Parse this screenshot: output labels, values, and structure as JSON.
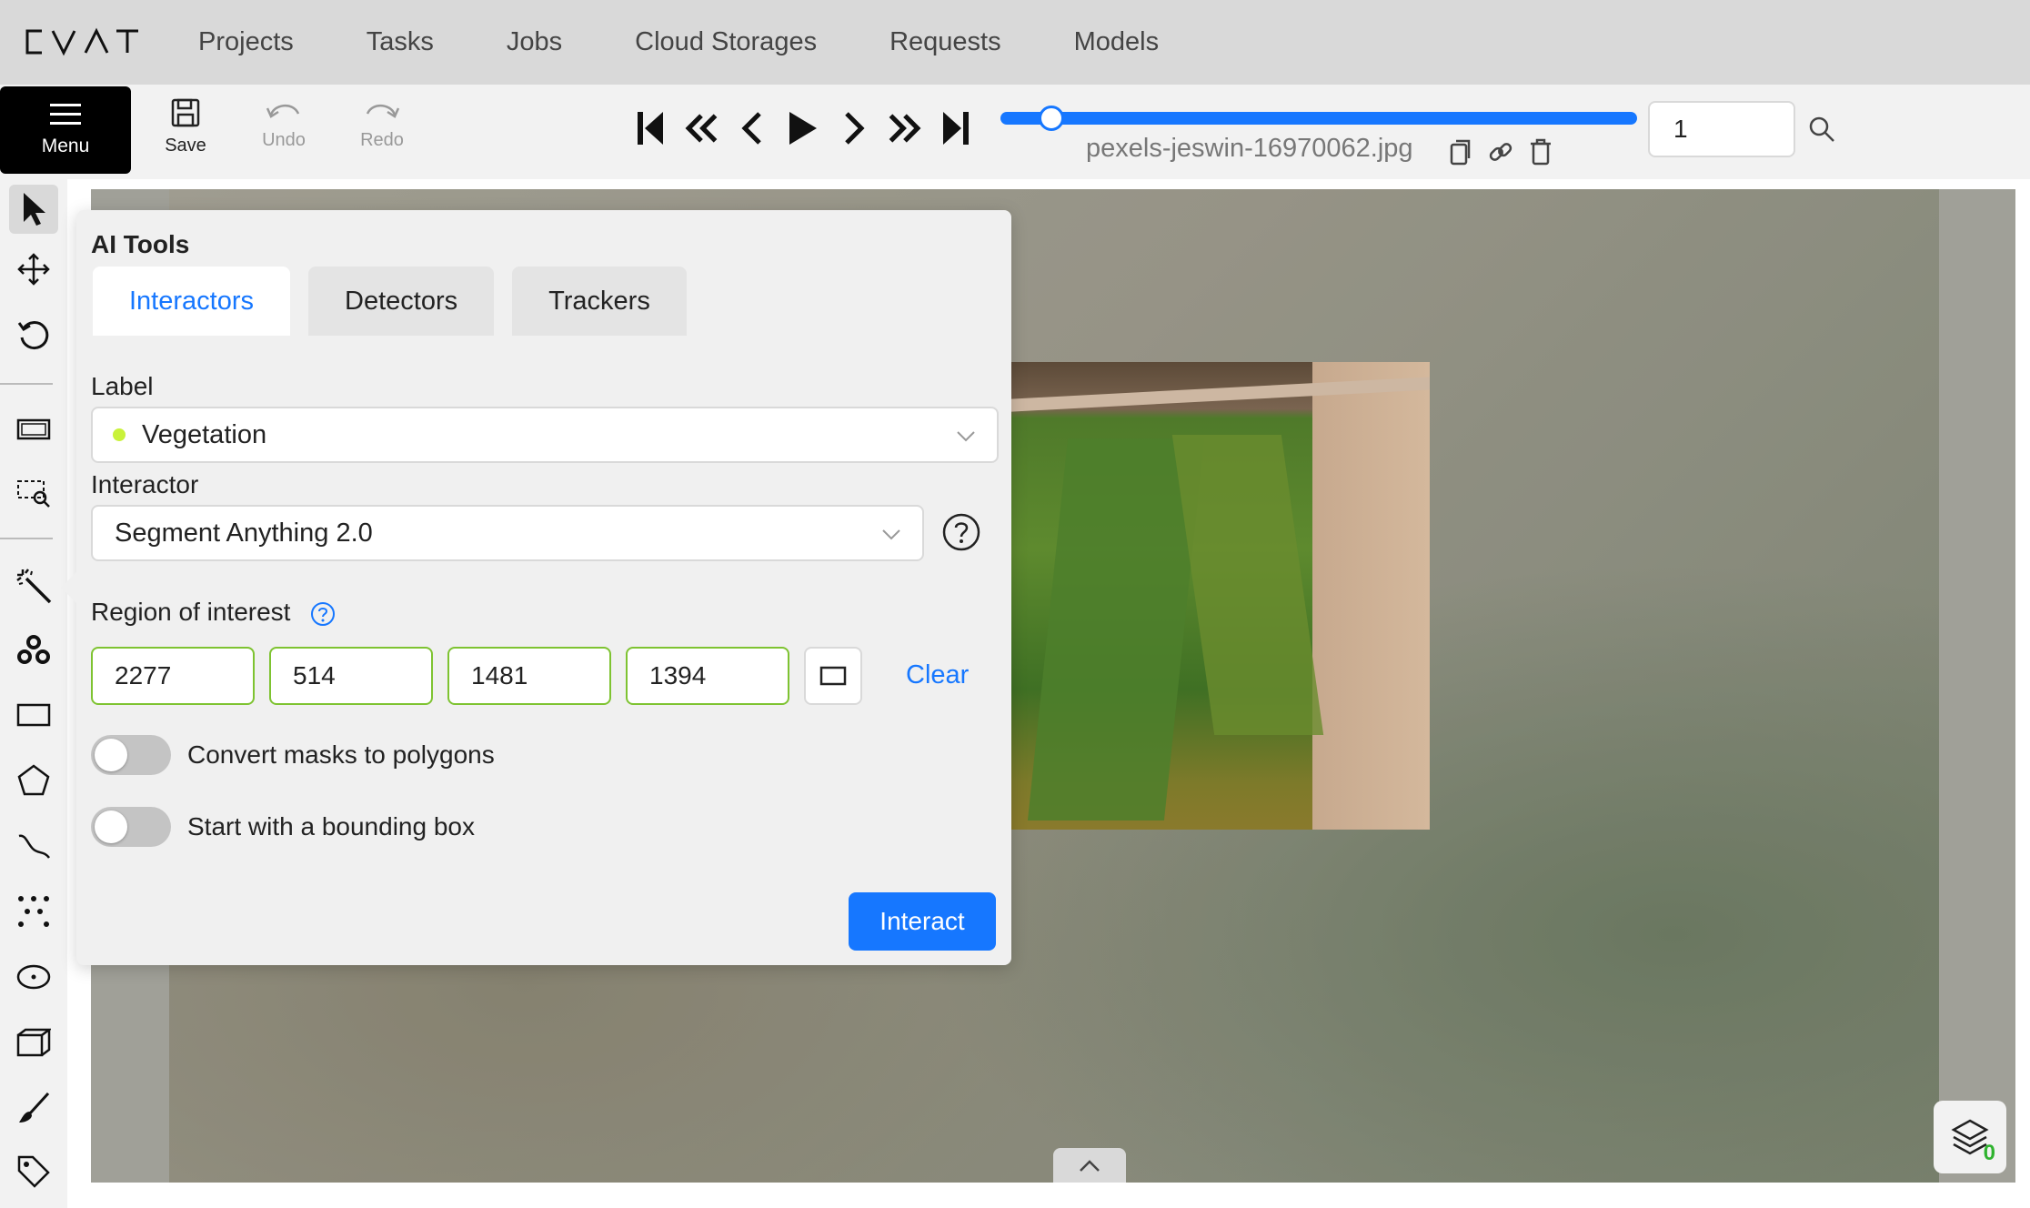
{
  "app": {
    "logo_text": "CVAT"
  },
  "nav": {
    "items": [
      "Projects",
      "Tasks",
      "Jobs",
      "Cloud Storages",
      "Requests",
      "Models"
    ]
  },
  "toolbar": {
    "menu_label": "Menu",
    "save_label": "Save",
    "undo_label": "Undo",
    "redo_label": "Redo",
    "filename": "pexels-jeswin-16970062.jpg",
    "frame_value": "1",
    "player_progress_fraction": 0.06
  },
  "ai_tools": {
    "title": "AI Tools",
    "tabs": [
      {
        "label": "Interactors",
        "active": true
      },
      {
        "label": "Detectors",
        "active": false
      },
      {
        "label": "Trackers",
        "active": false
      }
    ],
    "label_field": {
      "caption": "Label",
      "value": "Vegetation",
      "color": "#c9f23a"
    },
    "interactor_field": {
      "caption": "Interactor",
      "value": "Segment Anything 2.0"
    },
    "region_of_interest": {
      "caption": "Region of interest",
      "values": [
        "2277",
        "514",
        "1481",
        "1394"
      ],
      "clear_label": "Clear"
    },
    "switches": [
      {
        "label": "Convert masks to polygons",
        "on": false
      },
      {
        "label": "Start with a bounding box",
        "on": false
      }
    ],
    "interact_label": "Interact"
  },
  "canvas": {
    "layers_count": "0"
  },
  "colors": {
    "accent": "#1677ff",
    "roi_border": "#7ec331",
    "nav_bg": "#d9d9d9",
    "toolbar_bg": "#f2f2f2"
  }
}
